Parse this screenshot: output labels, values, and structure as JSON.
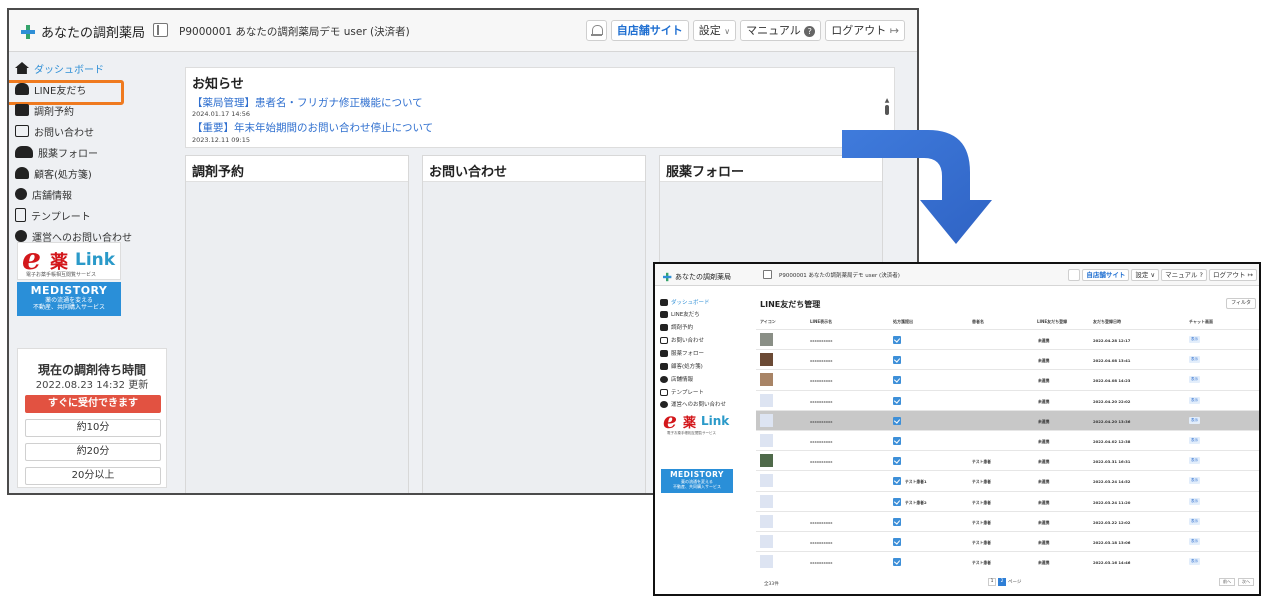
{
  "dashboard": {
    "header": {
      "app_name": "あなたの調剤薬局",
      "store_label": "P9000001 あなたの調剤薬局デモ user (決済者)",
      "store_site": "自店舗サイト",
      "settings": "設定",
      "settings_caret": "∨",
      "manual": "マニュアル",
      "manual_help": "?",
      "logout": "ログアウト",
      "logout_icon": "↦"
    },
    "sidebar": {
      "items": [
        {
          "label": "ダッシュボード",
          "icon": "home-icon"
        },
        {
          "label": "LINE友だち",
          "icon": "users-icon"
        },
        {
          "label": "調剤予約",
          "icon": "calendar-icon"
        },
        {
          "label": "お問い合わせ",
          "icon": "mail-icon"
        },
        {
          "label": "服薬フォロー",
          "icon": "pharmacist-icon"
        },
        {
          "label": "顧客(処方箋)",
          "icon": "customer-icon"
        },
        {
          "label": "店舗情報",
          "icon": "gear-icon"
        },
        {
          "label": "テンプレート",
          "icon": "document-icon"
        },
        {
          "label": "運営へのお問い合わせ",
          "icon": "question-icon"
        }
      ],
      "banner_logo": {
        "kanji": "薬",
        "link": "Link",
        "small": "電子お薬手帳相互閲覧サービス"
      },
      "medistory": {
        "title": "MEDISTORY",
        "line1": "薬の流通を変える",
        "line2": "不動産、共同購入サービス"
      },
      "wait": {
        "title": "現在の調剤待ち時間",
        "updated": "2022.08.23 14:32 更新",
        "options": [
          "すぐに受付できます",
          "約10分",
          "約20分",
          "20分以上"
        ]
      }
    },
    "news": {
      "title": "お知らせ",
      "items": [
        {
          "text": "【薬局管理】患者名・フリガナ修正機能について",
          "date": "2024.01.17 14:56"
        },
        {
          "text": "【重要】年末年始期間のお問い合わせ停止について",
          "date": "2023.12.11 09:15"
        }
      ]
    },
    "panels": [
      "調剤予約",
      "お問い合わせ",
      "服薬フォロー"
    ]
  },
  "line_friends": {
    "header": {
      "app_name": "あなたの調剤薬局",
      "store_label": "P9000001 あなたの調剤薬局デモ user (決済者)",
      "store_site": "自店舗サイト",
      "settings": "設定 ∨",
      "manual": "マニュアル ?",
      "logout": "ログアウト ↦"
    },
    "sidebar_items": [
      "ダッシュボード",
      "LINE友だち",
      "調剤予約",
      "お問い合わせ",
      "服薬フォロー",
      "顧客(処方箋)",
      "店舗情報",
      "テンプレート",
      "運営へのお問い合わせ"
    ],
    "banner_logo": {
      "kanji": "薬",
      "link": "Link",
      "small": "電子お薬手帳相互閲覧サービス"
    },
    "medistory": {
      "title": "MEDISTORY",
      "line1": "薬の流通を変える",
      "line2": "不動産、共同購入サービス"
    },
    "title": "LINE友だち管理",
    "filter": "フィルタ",
    "columns": [
      "アイコン",
      "LINE表示名",
      "処方箋提出",
      "患者名",
      "LINE友だち登録",
      "友だち登録日時",
      "チャット画面"
    ],
    "rows": [
      {
        "line_name": "xxxxxxxxxx",
        "patient": "",
        "status": "未連携",
        "date": "2022.04.28 12:17",
        "action": "表示",
        "selected": false,
        "avatar": "#8a8f86"
      },
      {
        "line_name": "xxxxxxxxxx",
        "patient": "",
        "status": "未連携",
        "date": "2022.04.08 13:41",
        "action": "表示",
        "selected": false,
        "avatar": "#6b4a35"
      },
      {
        "line_name": "xxxxxxxxxx",
        "patient": "",
        "status": "未連携",
        "date": "2022.04.08 14:23",
        "action": "表示",
        "selected": false,
        "avatar": "#a88466"
      },
      {
        "line_name": "xxxxxxxxxx",
        "patient": "",
        "status": "未連携",
        "date": "2022.04.20 22:02",
        "action": "表示",
        "selected": false,
        "avatar": "#dde4f2"
      },
      {
        "line_name": "xxxxxxxxxx",
        "patient": "",
        "status": "未連携",
        "date": "2022.04.20 13:36",
        "action": "表示",
        "selected": true,
        "avatar": "#dde4f2"
      },
      {
        "line_name": "xxxxxxxxxx",
        "patient": "",
        "status": "未連携",
        "date": "2022.04.02 12:38",
        "action": "表示",
        "selected": false,
        "avatar": "#dde4f2"
      },
      {
        "line_name": "xxxxxxxxxx",
        "patient": "テスト患者",
        "status": "未連携",
        "date": "2022.03.31 16:31",
        "action": "表示",
        "selected": false,
        "avatar": "#4f6a4a"
      },
      {
        "line_name": "",
        "rx_name": "テスト患者1",
        "patient": "テスト患者",
        "status": "未連携",
        "date": "2022.03.24 14:52",
        "action": "表示",
        "selected": false,
        "avatar": "#dde4f2"
      },
      {
        "line_name": "",
        "rx_name": "テスト患者2",
        "patient": "テスト患者",
        "status": "未連携",
        "date": "2022.03.24 11:20",
        "action": "表示",
        "selected": false,
        "avatar": "#dde4f2"
      },
      {
        "line_name": "xxxxxxxxxx",
        "patient": "テスト患者",
        "status": "未連携",
        "date": "2022.03.22 12:02",
        "action": "表示",
        "selected": false,
        "avatar": "#dde4f2"
      },
      {
        "line_name": "xxxxxxxxxx",
        "patient": "テスト患者",
        "status": "未連携",
        "date": "2022.03.18 13:06",
        "action": "表示",
        "selected": false,
        "avatar": "#dde4f2"
      },
      {
        "line_name": "xxxxxxxxxx",
        "patient": "テスト患者",
        "status": "未連携",
        "date": "2022.03.16 14:46",
        "action": "表示",
        "selected": false,
        "avatar": "#dde4f2"
      }
    ],
    "footer": {
      "count": "全33件",
      "pages": [
        "1",
        "2"
      ],
      "page_label": "ページ",
      "prev": "前へ",
      "next": "次へ"
    }
  },
  "colors": {
    "accent_blue": "#2f6fcf",
    "highlight_orange": "#ef7a1f",
    "wait_red": "#e25241",
    "arrow_blue": "#3a6fcf"
  }
}
